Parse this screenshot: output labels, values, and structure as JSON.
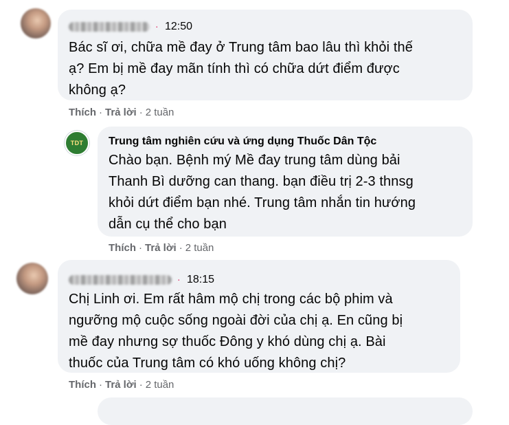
{
  "comments": [
    {
      "time": "12:50",
      "text": "Bác sĩ ơi, chữa mề đay ở Trung tâm bao lâu thì khỏi thế\nạ? Em bị mề đay mãn tính thì có chữa dứt điểm được\nkhông ạ?",
      "like": "Thích",
      "reply": "Trả lời",
      "age": "2 tuần"
    },
    {
      "author": "Trung tâm nghiên cứu và ứng dụng Thuốc Dân Tộc",
      "logo_text": "TDT",
      "text": "Chào bạn. Bệnh mý Mề đay trung tâm dùng bải\nThanh Bì dưỡng can thang. bạn điều trị 2-3 thnsg\nkhỏi dứt điểm bạn nhé. Trung tâm nhắn tin hướng\ndẫn cụ thể cho bạn",
      "like": "Thích",
      "reply": "Trả lời",
      "age": "2 tuần"
    },
    {
      "time": "18:15",
      "text": "Chị Linh ơi. Em rất hâm mộ chị trong các bộ phim và\nngưỡng mộ cuộc sống ngoài đời của chị ạ. En cũng bị\nmề đay nhưng sợ thuốc Đông y khó dùng chị ạ. Bài\nthuốc của Trung tâm có khó uống không chị?",
      "like": "Thích",
      "reply": "Trả lời",
      "age": "2 tuần"
    }
  ],
  "separator": "·",
  "colors": {
    "bubble": "#f0f2f5",
    "meta": "#65676b",
    "dot": "#e0245e",
    "logo_bg": "#2e7d32"
  }
}
